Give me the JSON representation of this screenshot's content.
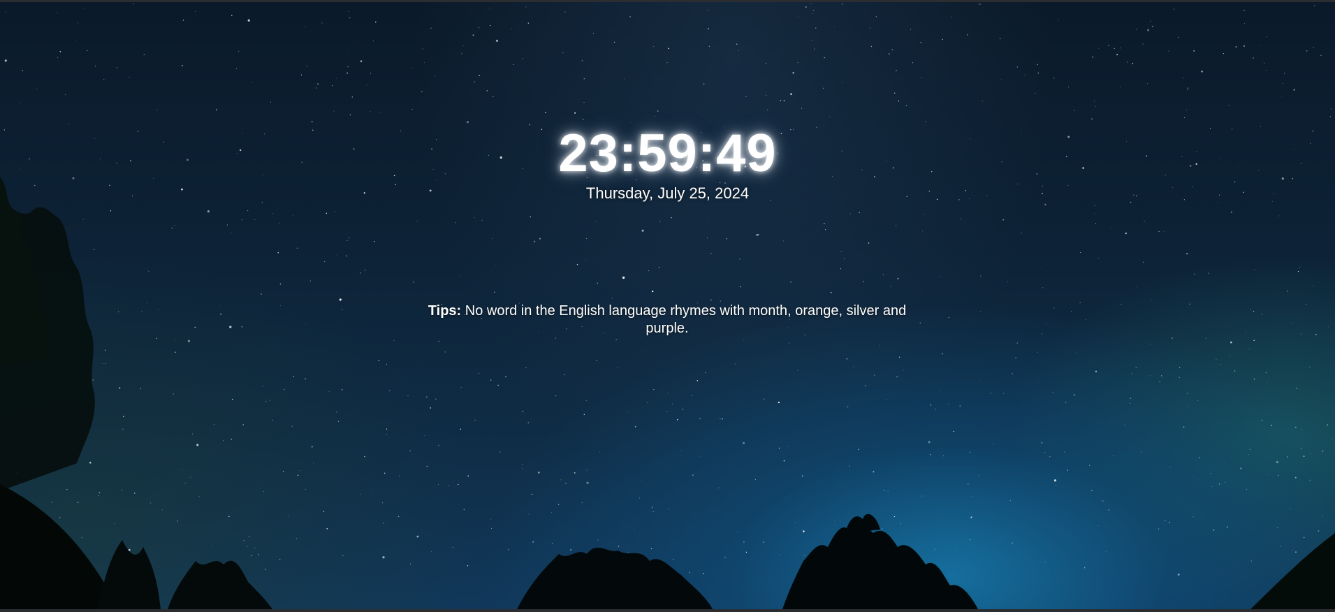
{
  "clock": {
    "time": "23:59:49",
    "date": "Thursday, July 25, 2024"
  },
  "tips": {
    "label": "Tips:",
    "text": "No word in the English language rhymes with month, orange, silver and purple."
  },
  "background": {
    "icon": "starry-night-sky",
    "accent": "#11385a"
  }
}
